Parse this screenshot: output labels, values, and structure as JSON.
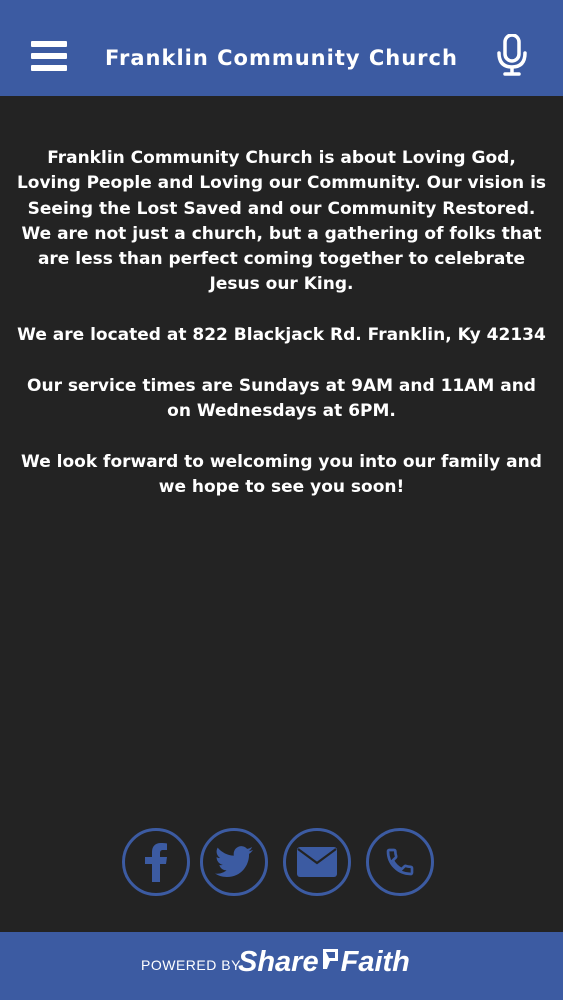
{
  "header": {
    "title": "Franklin Community Church",
    "menu_icon": "hamburger-menu-icon",
    "mic_icon": "microphone-icon"
  },
  "content": {
    "paragraphs": [
      "Franklin Community Church is about Loving God, Loving People and Loving our Community.  Our vision is Seeing the Lost Saved and our Community Restored.  We are not just a church, but a gathering of folks that are less than perfect coming together to celebrate Jesus our King.",
      "We are located at 822 Blackjack Rd. Franklin, Ky 42134",
      "Our service times are Sundays at 9AM and 11AM and on Wednesdays at 6PM.",
      "We look forward to welcoming you into our family and we hope to see you soon!"
    ]
  },
  "social": {
    "buttons": [
      {
        "name": "facebook",
        "icon": "facebook-icon"
      },
      {
        "name": "twitter",
        "icon": "twitter-icon"
      },
      {
        "name": "email",
        "icon": "envelope-icon"
      },
      {
        "name": "phone",
        "icon": "phone-icon"
      }
    ]
  },
  "footer": {
    "powered_by": "POWERED BY",
    "brand_left": "Share",
    "brand_right": "Faith"
  },
  "colors": {
    "brand_blue": "#3c5ba2",
    "background": "#232323",
    "text": "#ffffff"
  }
}
